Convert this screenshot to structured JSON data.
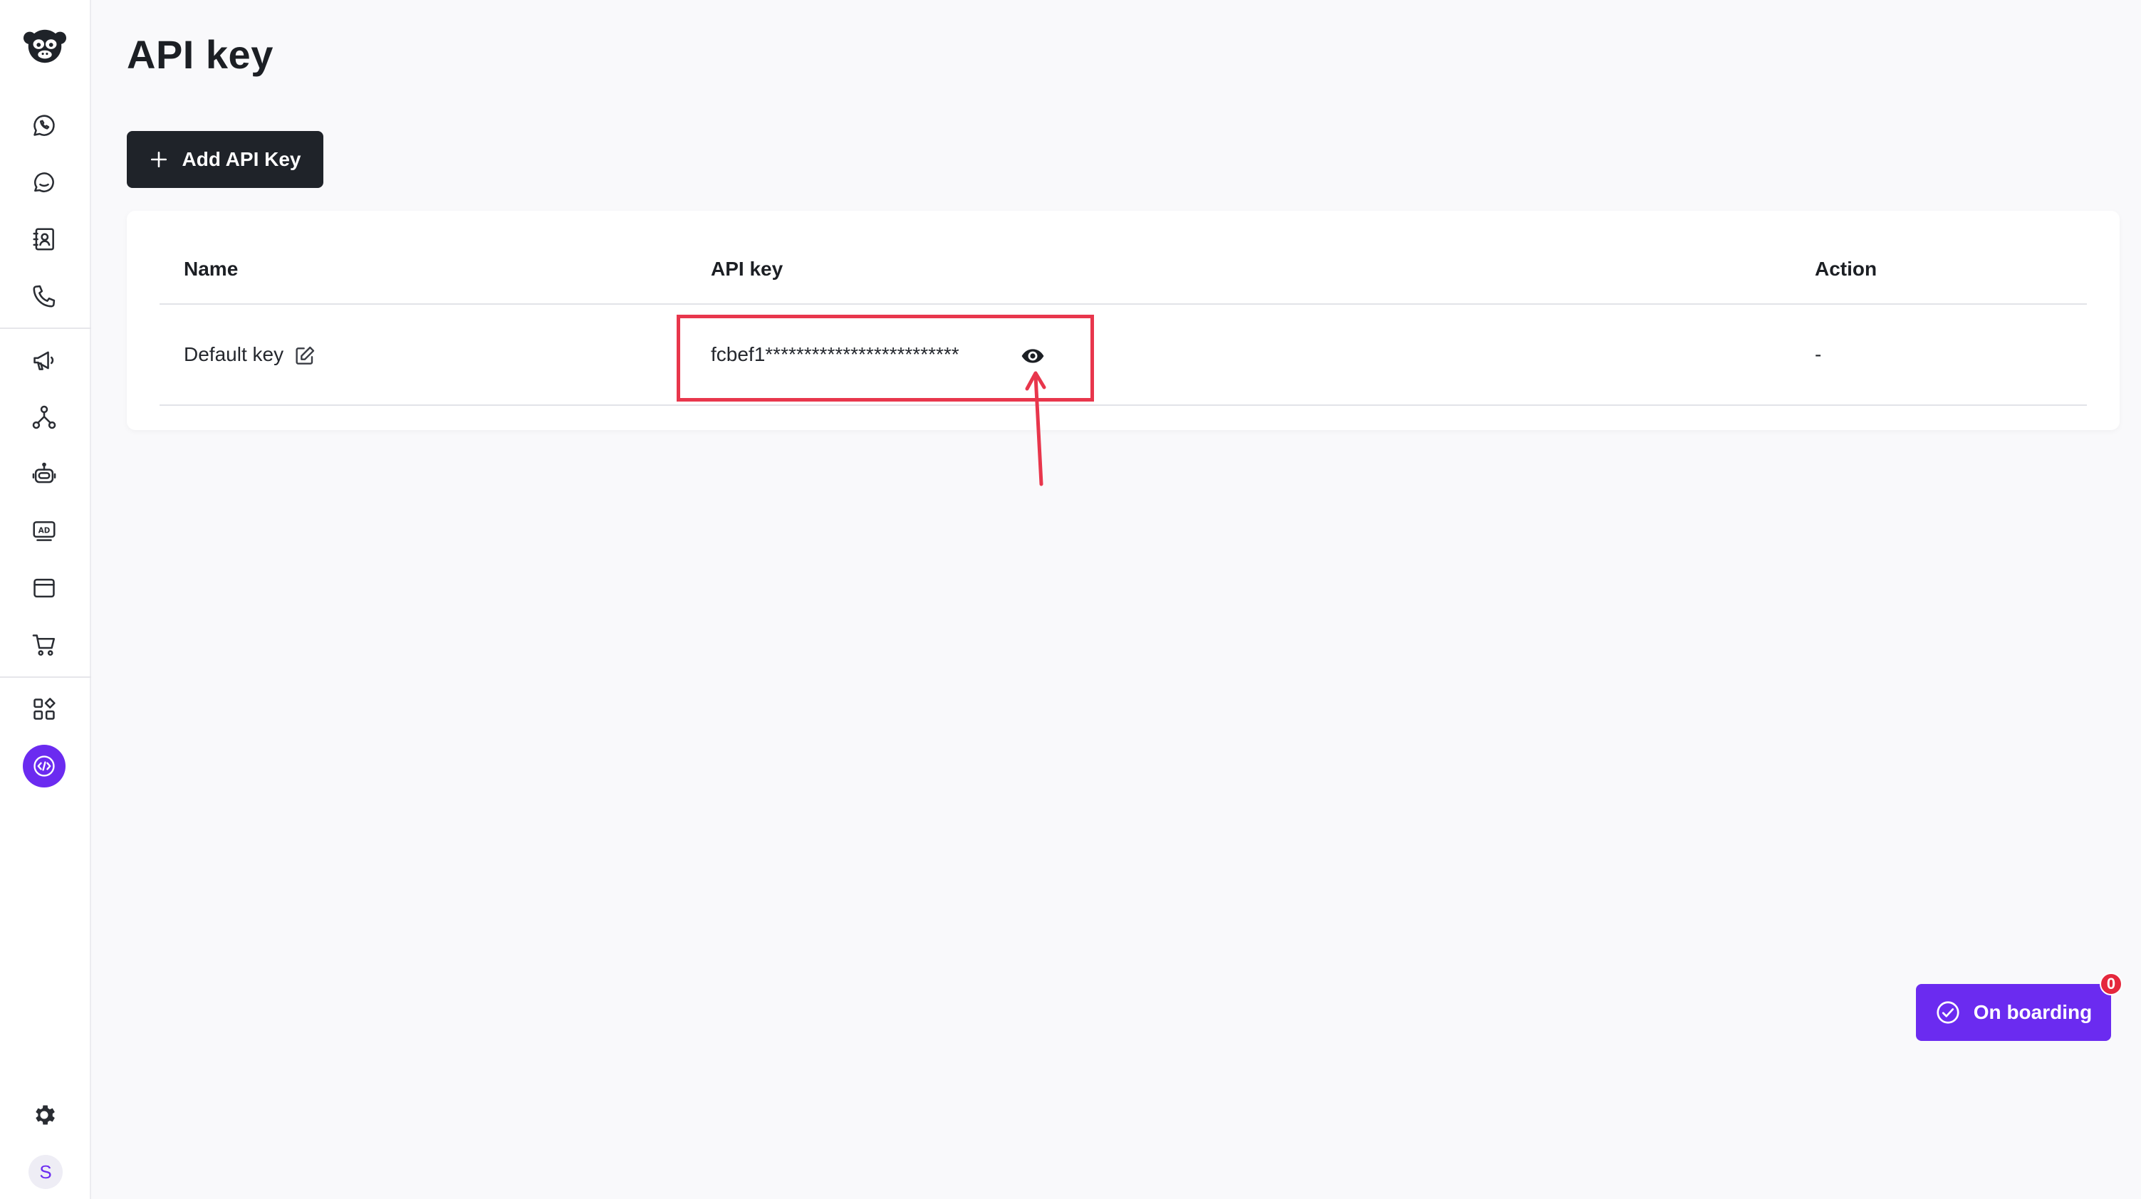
{
  "page": {
    "title": "API key",
    "add_button_label": "Add API Key"
  },
  "table": {
    "headers": {
      "name": "Name",
      "api_key": "API key",
      "action": "Action"
    },
    "rows": [
      {
        "name": "Default key",
        "api_key": "fcbef1*************************",
        "action": "-"
      }
    ]
  },
  "onboarding": {
    "label": "On boarding",
    "count": "0"
  },
  "user": {
    "avatar_initial": "S"
  },
  "colors": {
    "accent": "#6b2bf0",
    "highlight": "#e8364c",
    "badge": "#e5283d",
    "dark_button": "#1f2329"
  }
}
